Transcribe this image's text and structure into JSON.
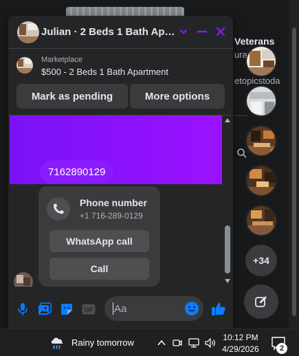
{
  "background": {
    "title": "Veterans",
    "subtitle": "ura",
    "handle": "etopicstoda",
    "more_count": "+34"
  },
  "chat": {
    "title": "Julian · 2 Beds 1 Bath Apar...",
    "listing": {
      "source": "Marketplace",
      "title": "$500 - 2 Beds 1 Bath Apartment"
    },
    "actions": {
      "mark_pending": "Mark as pending",
      "more_options": "More options"
    },
    "phone_message": "7162890129",
    "phone_card": {
      "title": "Phone number",
      "number": "+1 716-289-0129",
      "whatsapp_label": "WhatsApp call",
      "call_label": "Call"
    },
    "composer": {
      "placeholder": "Aa",
      "gif_label": "GIF"
    }
  },
  "taskbar": {
    "weather": "Rainy tomorrow",
    "time": "10:12 PM",
    "date": "4/29/2026",
    "notification_count": "2"
  },
  "colors": {
    "accent": "#8a1bff",
    "messenger_blue": "#0a7cff",
    "panel": "#242526",
    "button": "#3a3b3c"
  }
}
